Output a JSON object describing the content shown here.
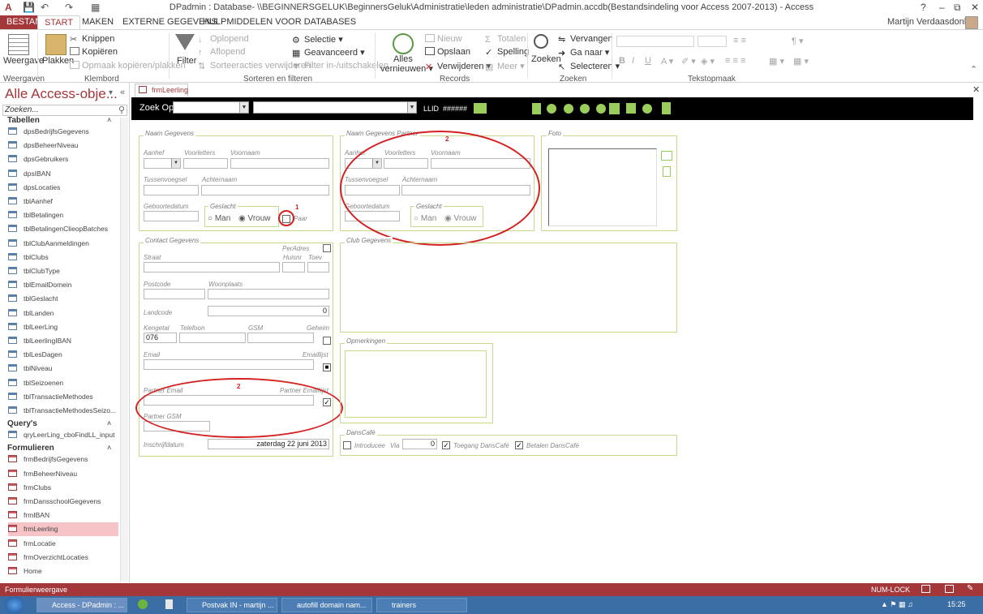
{
  "window": {
    "title": "DPadmin : Database- \\\\BEGINNERSGELUK\\BeginnersGeluk\\Administratie\\leden administratie\\DPadmin.accdb(Bestandsindeling voor Access 2007-2013) - Access",
    "user": "Martijn Verdaasdonk",
    "help": "?"
  },
  "tabs": {
    "file": "BESTAND",
    "start": "START",
    "create": "MAKEN",
    "external": "EXTERNE GEGEVENS",
    "tools": "HULPMIDDELEN VOOR DATABASES"
  },
  "ribbon": {
    "views": {
      "label": "Weergave",
      "group": "Weergaven"
    },
    "clipboard": {
      "paste": "Plakken",
      "cut": "Knippen",
      "copy": "Kopiëren",
      "format_painter": "Opmaak kopiëren/plakken",
      "group": "Klembord"
    },
    "sort": {
      "filter": "Filter",
      "ascending": "Oplopend",
      "descending": "Aflopend",
      "remove_sort": "Sorteeracties verwijderen",
      "selection": "Selectie",
      "advanced": "Geavanceerd",
      "toggle_filter": "Filter in-/uitschakelen",
      "group": "Sorteren en filteren"
    },
    "records": {
      "refresh_all_1": "Alles",
      "refresh_all_2": "vernieuwen",
      "new": "Nieuw",
      "save": "Opslaan",
      "delete": "Verwijderen",
      "totals": "Totalen",
      "spelling": "Spelling",
      "more": "Meer",
      "group": "Records"
    },
    "find": {
      "find": "Zoeken",
      "replace": "Vervangen",
      "goto": "Ga naar",
      "select": "Selecteren",
      "group": "Zoeken"
    },
    "text_format": {
      "bold": "B",
      "italic": "I",
      "underline": "U",
      "group": "Tekstopmaak"
    }
  },
  "nav": {
    "header": "Alle Access-obje...",
    "search_placeholder": "Zoeken...",
    "categories": {
      "tables": "Tabellen",
      "queries": "Query's",
      "forms": "Formulieren"
    },
    "tables": [
      "dpsBedrijfsGegevens",
      "dpsBeheerNiveau",
      "dpsGebruikers",
      "dpsIBAN",
      "dpsLocaties",
      "tblAanhef",
      "tblBetalingen",
      "tblBetalingenClieopBatches",
      "tblClubAanmeldingen",
      "tblClubs",
      "tblClubType",
      "tblEmailDomein",
      "tblGeslacht",
      "tblLanden",
      "tblLeerLing",
      "tblLeerlingIBAN",
      "tblLesDagen",
      "tblNiveau",
      "tblSeizoenen",
      "tblTransactieMethodes",
      "tblTransactieMethodesSeizo..."
    ],
    "queries": [
      "qryLeerLing_cboFindLL_input"
    ],
    "forms": [
      "frmBedrijfsGegevens",
      "frmBeheerNiveau",
      "frmClubs",
      "frmDansschoolGegevens",
      "frmIBAN",
      "frmLeerling",
      "frmLocatie",
      "frmOverzichtLocaties",
      "Home"
    ],
    "selected_form": "frmLeerling"
  },
  "document": {
    "tab": "frmLeerling"
  },
  "header_bar": {
    "zoek_op": "Zoek Op",
    "llid": "LLID",
    "llid_value": "######"
  },
  "form": {
    "naam": {
      "title": "Naam Gegevens",
      "aanhef": "Aanhef",
      "voorletters": "Voorletters",
      "voornaam": "Voornaam",
      "tussenvoegsel": "Tussenvoegsel",
      "achternaam": "Achternaam",
      "geboortedatum": "Geboortedatum",
      "geslacht": "Geslacht",
      "man": "Man",
      "vrouw": "Vrouw",
      "paar": "Paar"
    },
    "partner": {
      "title": "Naam Gegevens Partner",
      "aanhef": "Aanhef",
      "voorletters": "Voorletters",
      "voornaam": "Voornaam",
      "tussenvoegsel": "Tussenvoegsel",
      "achternaam": "Achternaam",
      "geboortedatum": "Geboortedatum",
      "geslacht": "Geslacht",
      "man": "Man",
      "vrouw": "Vrouw"
    },
    "foto": {
      "title": "Foto"
    },
    "contact": {
      "title": "Contact Gegevens",
      "peradres": "PerAdres",
      "straat": "Straat",
      "huisnr": "Huisnr",
      "toev": "Toev",
      "postcode": "Postcode",
      "woonplaats": "Woonplaats",
      "landcode": "Landcode",
      "landcode_value": "0",
      "kengetal": "Kengetal",
      "kengetal_value": "076",
      "telefoon": "Telefoon",
      "gsm": "GSM",
      "geheim": "Geheim",
      "email": "Email",
      "emaillijst": "Emaillijst",
      "partner_email": "Partner Email",
      "partner_emaillijst": "Partner Emaillijst",
      "partner_gsm": "Partner GSM",
      "inschrijfdatum": "Inschrijfdatum",
      "inschrijfdatum_value": "zaterdag 22 juni 2013"
    },
    "club": {
      "title": "Club Gegevens"
    },
    "opmerkingen": {
      "title": "Opmerkingen"
    },
    "danscafe": {
      "title": "DansCafé",
      "introducee": "Introducee",
      "via": "Via",
      "via_value": "0",
      "toegang": "Toegang DansCafé",
      "betalen": "Betalen DansCafé"
    },
    "annotations": {
      "one": "1",
      "two": "2"
    }
  },
  "status": {
    "view": "Formulierweergave",
    "numlock": "NUM-LOCK"
  },
  "taskbar": {
    "items": [
      "Access - DPadmin : ...",
      "Postvak IN - martijn ...",
      "autofill domain nam...",
      "trainers"
    ],
    "time": "15:25"
  },
  "colors": {
    "accent": "#a4373a",
    "frame_green": "#c6d98c",
    "annotation_red": "#d42020",
    "nav_green": "#9acd5c"
  }
}
